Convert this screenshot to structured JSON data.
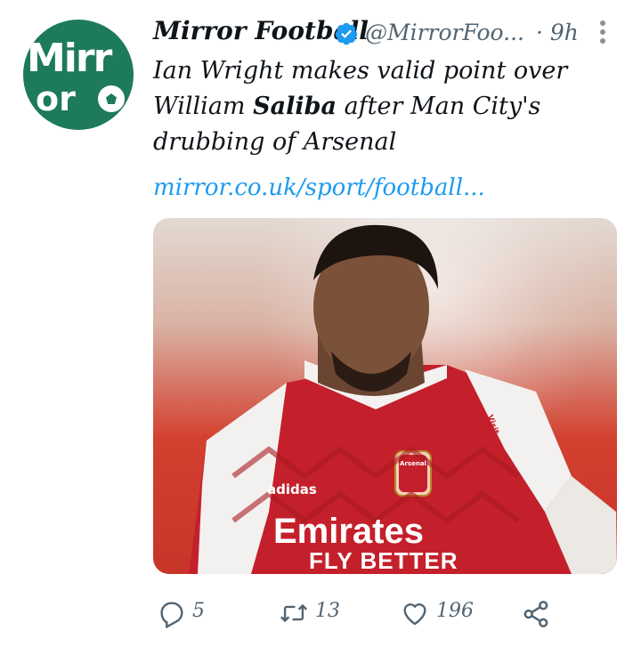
{
  "tweet": {
    "author_name": "Mirror Football",
    "handle": "@MirrorFoo...",
    "separator": "·",
    "time": "9h",
    "text_parts": [
      "Ian Wright makes valid point over William ",
      "Saliba",
      " after Man City's drubbing of Arsenal"
    ],
    "link": "mirror.co.uk/sport/football...",
    "avatar_text_top": "Mirr",
    "avatar_text_bottom": "or",
    "media": {
      "sponsor_line1": "Emirates",
      "sponsor_line2": "FLY BETTER",
      "kit_brand": "adidas",
      "crest_text": "Arsenal",
      "sleeve_text": "Visit Rwanda"
    }
  },
  "actions": {
    "replies": "5",
    "retweets": "13",
    "likes": "196"
  },
  "colors": {
    "accent": "#1d9bf0",
    "text": "#0f1419",
    "muted": "#536471",
    "avatar_bg": "#1d7a5a",
    "arsenal_red": "#c4202b"
  },
  "icons": [
    "verified-icon",
    "more-icon",
    "reply-icon",
    "retweet-icon",
    "like-icon",
    "share-icon"
  ]
}
